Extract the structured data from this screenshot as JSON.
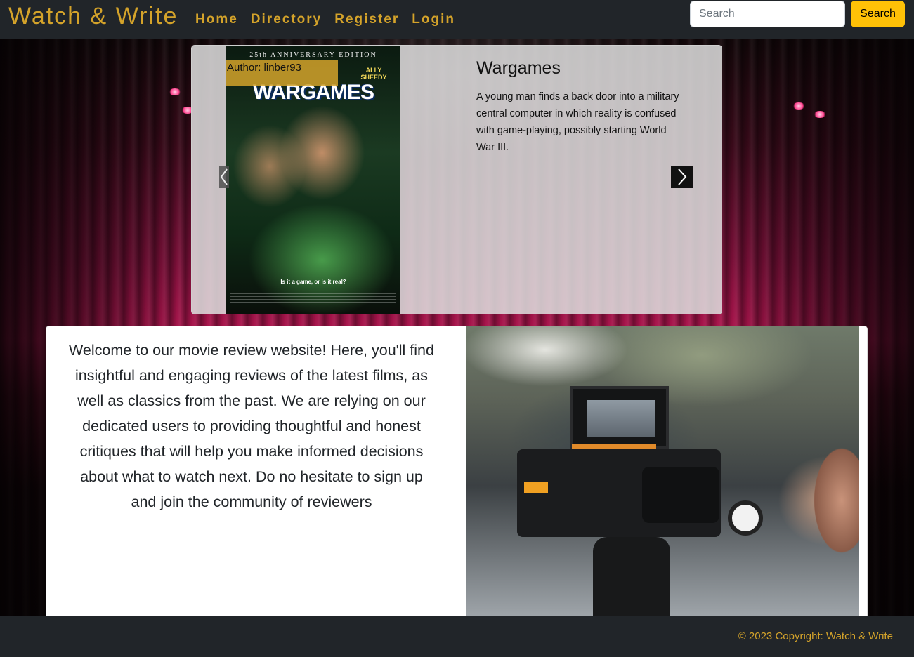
{
  "navbar": {
    "brand": "Watch & Write",
    "links": [
      "Home",
      "Directory",
      "Register",
      "Login"
    ],
    "search_placeholder": "Search",
    "search_button": "Search"
  },
  "carousel": {
    "author_label": "Author: linber93",
    "title": "Wargames",
    "description": "A young man finds a back door into a military central computer in which reality is confused with game-playing, possibly starting World War III.",
    "poster": {
      "top_line": "25th ANNIVERSARY EDITION",
      "title": "WARGAMES",
      "cast": "ALLY SHEEDY",
      "tagline": "Is it a game, or is it real?"
    }
  },
  "welcome": {
    "text": "Welcome to our movie review website! Here, you'll find insightful and engaging reviews of the latest films, as well as classics from the past. We are relying on our dedicated users to providing thoughtful and honest critiques that will help you make informed decisions about what to watch next. Do no hesitate to sign up and join the community of reviewers"
  },
  "footer": {
    "copyright": "© 2023 Copyright: Watch & Write"
  },
  "colors": {
    "accent": "#d4a32a",
    "navbar": "#212529",
    "search_button": "#ffc107"
  },
  "icons": {
    "prev": "chevron-left-icon",
    "next": "chevron-right-icon"
  }
}
